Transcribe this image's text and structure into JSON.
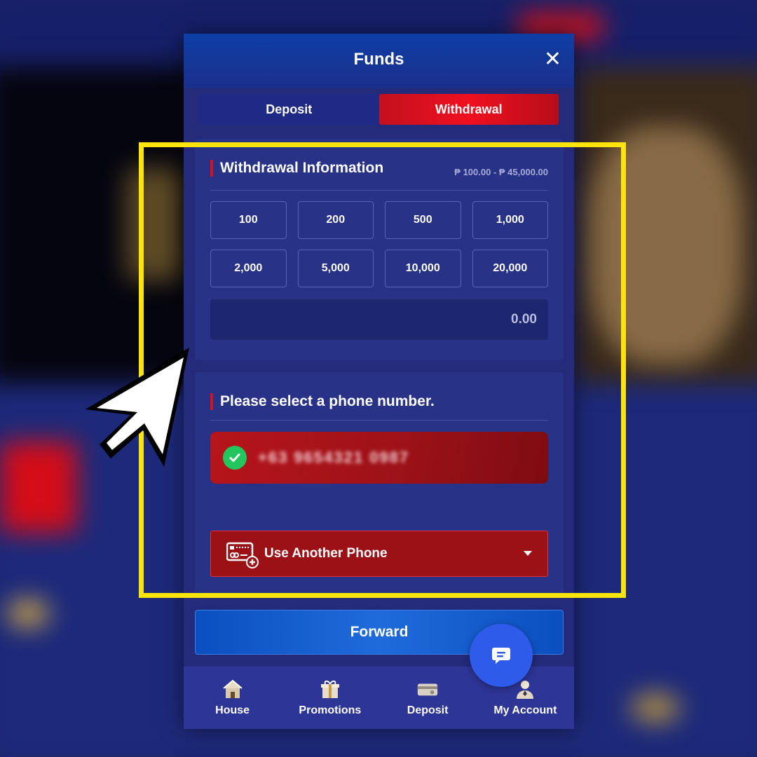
{
  "modal": {
    "title": "Funds",
    "close_symbol": "✕",
    "tabs": [
      {
        "label": "Deposit",
        "active": false
      },
      {
        "label": "Withdrawal",
        "active": true
      }
    ]
  },
  "withdrawal": {
    "title": "Withdrawal Information",
    "range": "₱ 100.00 - ₱ 45,000.00",
    "amounts": [
      "100",
      "200",
      "500",
      "1,000",
      "2,000",
      "5,000",
      "10,000",
      "20,000"
    ],
    "amount_value": "0.00"
  },
  "phone": {
    "title": "Please select a phone number.",
    "selected_number": "+63 9654321 0987",
    "another_label": "Use Another Phone"
  },
  "forward_label": "Forward",
  "nav": [
    {
      "label": "House",
      "icon": "house-icon"
    },
    {
      "label": "Promotions",
      "icon": "gift-icon"
    },
    {
      "label": "Deposit",
      "icon": "deposit-icon"
    },
    {
      "label": "My Account",
      "icon": "account-icon"
    }
  ],
  "colors": {
    "highlight": "#ffe40b",
    "accent_red": "#e0101f",
    "accent_blue": "#2f5bea"
  }
}
